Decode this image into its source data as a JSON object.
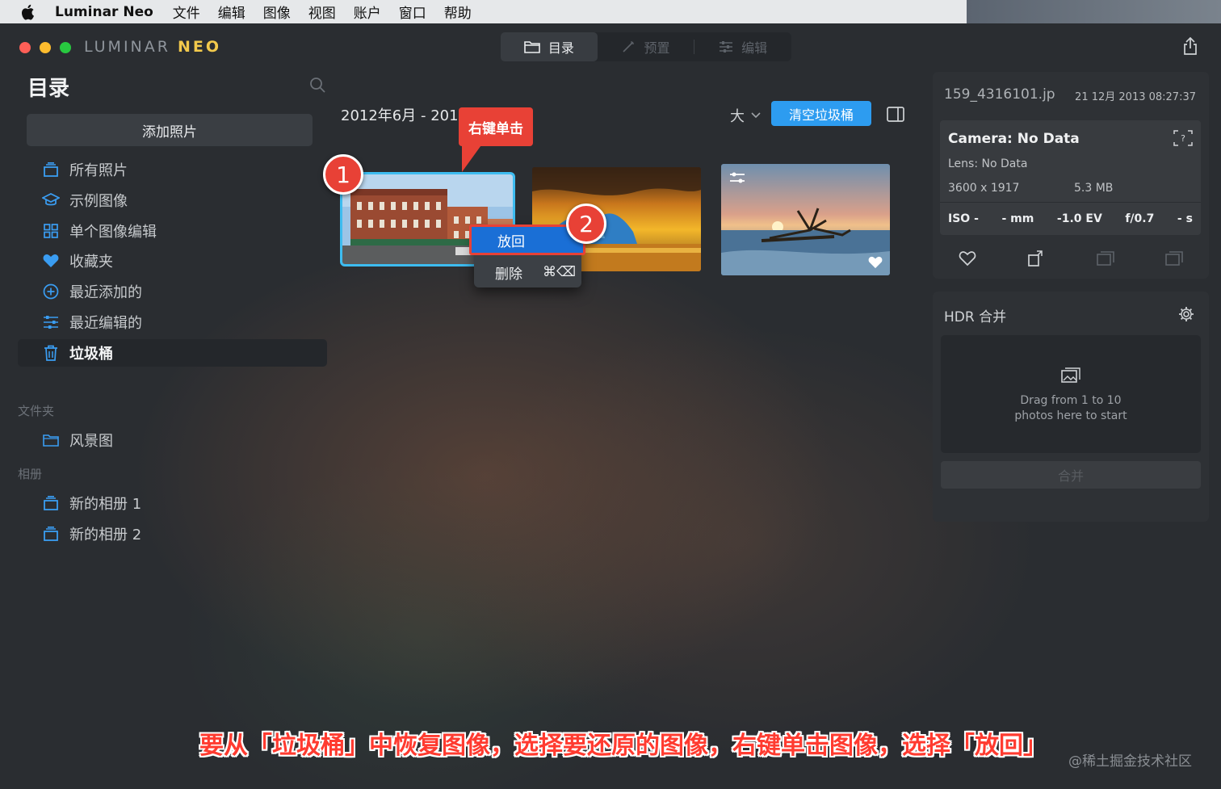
{
  "menubar": {
    "app_name": "Luminar Neo",
    "items": [
      "文件",
      "编辑",
      "图像",
      "视图",
      "账户",
      "窗口",
      "帮助"
    ]
  },
  "titlebar": {
    "logo_prefix": "LUMINAR ",
    "logo_suffix": "NEO",
    "tabs": [
      {
        "label": "目录",
        "icon": "folder-icon",
        "active": true
      },
      {
        "label": "预置",
        "icon": "wand-icon",
        "active": false
      },
      {
        "label": "编辑",
        "icon": "sliders-icon",
        "active": false
      }
    ]
  },
  "sidebar": {
    "title": "目录",
    "add_button": "添加照片",
    "items": [
      {
        "label": "所有照片",
        "icon": "photos-stack-icon",
        "active": false
      },
      {
        "label": "示例图像",
        "icon": "graduation-cap-icon",
        "active": false
      },
      {
        "label": "单个图像编辑",
        "icon": "grid-icon",
        "active": false
      },
      {
        "label": "收藏夹",
        "icon": "heart-icon",
        "active": false
      },
      {
        "label": "最近添加的",
        "icon": "plus-circle-icon",
        "active": false
      },
      {
        "label": "最近编辑的",
        "icon": "sliders-icon",
        "active": false
      },
      {
        "label": "垃圾桶",
        "icon": "trash-icon",
        "active": true
      }
    ],
    "folders_label": "文件夹",
    "folders": [
      {
        "label": "风景图",
        "icon": "folder-icon"
      }
    ],
    "albums_label": "相册",
    "albums": [
      {
        "label": "新的相册 1",
        "icon": "album-icon"
      },
      {
        "label": "新的相册 2",
        "icon": "album-icon"
      }
    ]
  },
  "main": {
    "date_range": "2012年6月 - 2018",
    "size_label": "大",
    "empty_trash_button": "清空垃圾桶",
    "thumbnails": [
      {
        "subject": "brick-buildings",
        "selected": true,
        "favorite": false,
        "edited": false
      },
      {
        "subject": "sunset-iceberg",
        "selected": false,
        "favorite": false,
        "edited": false
      },
      {
        "subject": "driftwood-sea",
        "selected": false,
        "favorite": true,
        "edited": true
      }
    ]
  },
  "annotation": {
    "callout": "右键单击",
    "step1": "1",
    "step2": "2"
  },
  "context_menu": {
    "restore": "放回",
    "delete": "删除",
    "delete_shortcut": "⌘⌫"
  },
  "info": {
    "file_name": "159_4316101.jp",
    "date": "21 12月 2013 08:27:37",
    "camera": "Camera: No Data",
    "lens": "Lens: No Data",
    "dimensions": "3600 x 1917",
    "file_size": "5.3 MB",
    "exif": [
      "ISO -",
      "- mm",
      "-1.0 EV",
      "f/0.7",
      "- s"
    ]
  },
  "hdr": {
    "title": "HDR 合并",
    "drop_line1": "Drag from 1 to 10",
    "drop_line2": "photos here to start",
    "merge_button": "合并"
  },
  "caption": "要从「垃圾桶」中恢复图像，选择要还原的图像，右键单击图像，选择「放回」",
  "watermark": "@稀土掘金技术社区",
  "colors": {
    "accent_blue": "#2d9cf0",
    "annotation_red": "#e84136",
    "selection_outline": "#3dbcf0"
  }
}
